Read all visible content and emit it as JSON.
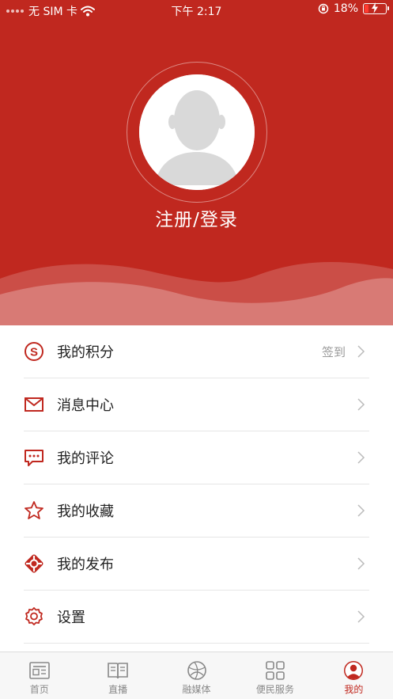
{
  "status_bar": {
    "carrier": "无 SIM 卡",
    "time": "下午 2:17",
    "battery": "18%",
    "battery_level": 0.18
  },
  "profile": {
    "login_label": "注册/登录"
  },
  "menu": [
    {
      "label": "我的积分",
      "extra": "签到",
      "icon": "points-icon"
    },
    {
      "label": "消息中心",
      "extra": "",
      "icon": "mail-icon"
    },
    {
      "label": "我的评论",
      "extra": "",
      "icon": "comment-icon"
    },
    {
      "label": "我的收藏",
      "extra": "",
      "icon": "star-icon"
    },
    {
      "label": "我的发布",
      "extra": "",
      "icon": "publish-icon"
    },
    {
      "label": "设置",
      "extra": "",
      "icon": "settings-icon"
    }
  ],
  "tabs": [
    {
      "label": "首页",
      "icon": "news-icon"
    },
    {
      "label": "直播",
      "icon": "book-icon"
    },
    {
      "label": "融媒体",
      "icon": "globe-icon"
    },
    {
      "label": "便民服务",
      "icon": "grid-icon"
    },
    {
      "label": "我的",
      "icon": "user-icon",
      "active": true
    }
  ],
  "colors": {
    "accent": "#c0281f",
    "divider": "#e6e6e6",
    "tab_inactive": "#888888"
  }
}
